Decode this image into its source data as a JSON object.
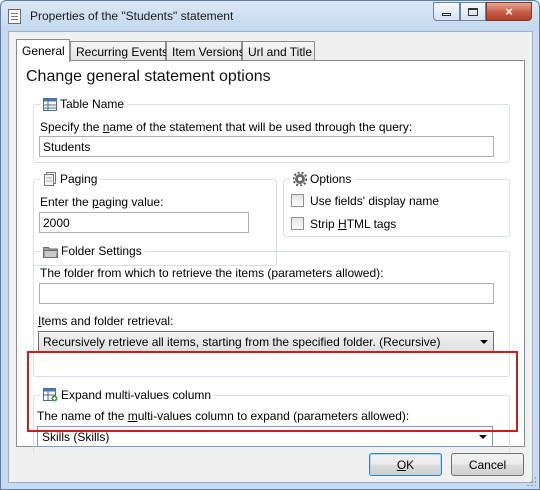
{
  "window": {
    "title": "Properties of the \"Students\" statement",
    "close_glyph": "×"
  },
  "tabs": [
    {
      "label": "General",
      "active": true
    },
    {
      "label": "Recurring Events",
      "active": false
    },
    {
      "label": "Item Versions",
      "active": false
    },
    {
      "label": "Url and Title",
      "active": false
    }
  ],
  "panel": {
    "heading": "Change general statement options"
  },
  "table_name": {
    "legend": "Table Name",
    "icon": "table-icon",
    "prompt_before": "Specify the ",
    "prompt_accel": "n",
    "prompt_after": "ame of the statement that will be used through the query:",
    "value": "Students"
  },
  "paging": {
    "legend": "Paging",
    "icon": "pages-icon",
    "prompt_before": "Enter the ",
    "prompt_accel": "p",
    "prompt_after": "aging value:",
    "value": "2000"
  },
  "options": {
    "legend": "Options",
    "icon": "gear-icon",
    "use_display_name_label": "Use fields' display name",
    "use_display_name_checked": false,
    "strip_before": "Strip ",
    "strip_accel": "H",
    "strip_after": "TML tags",
    "strip_html_checked": false
  },
  "folder": {
    "legend": "Folder Settings",
    "icon": "folder-icon",
    "prompt": "The folder from which to retrieve the items (parameters allowed):",
    "value": "",
    "retrieval_accel": "I",
    "retrieval_label": "tems and folder retrieval:",
    "retrieval_value": "Recursively retrieve all items, starting from the specified folder. (Recursive)"
  },
  "expand": {
    "legend": "Expand multi-values column",
    "icon": "expand-table-icon",
    "prompt_before": "The name of the ",
    "prompt_accel": "m",
    "prompt_after": "ulti-values column to expand (parameters allowed):",
    "value": "Skills (Skills)"
  },
  "buttons": {
    "ok_accel": "O",
    "ok_rest": "K",
    "cancel": "Cancel"
  },
  "colors": {
    "highlight_frame": "#d11a1a",
    "default_button_border": "#3c7fb1"
  }
}
